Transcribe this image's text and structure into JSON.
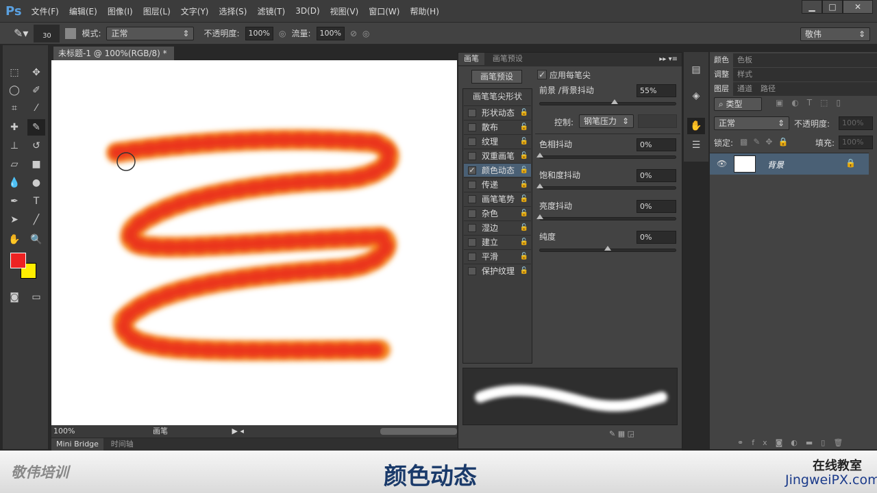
{
  "app": {
    "logo": "Ps",
    "menus": [
      "文件(F)",
      "编辑(E)",
      "图像(I)",
      "图层(L)",
      "文字(Y)",
      "选择(S)",
      "滤镜(T)",
      "3D(D)",
      "视图(V)",
      "窗口(W)",
      "帮助(H)"
    ],
    "win_min": "▁",
    "win_max": "□",
    "win_close": "✕"
  },
  "options": {
    "brush_size": "30",
    "mode_label": "模式:",
    "mode_value": "正常",
    "opacity_label": "不透明度:",
    "opacity_value": "100%",
    "flow_label": "流量:",
    "flow_value": "100%",
    "workspace": "敬伟"
  },
  "document": {
    "tab_title": "未标题-1 @ 100%(RGB/8) *",
    "close": "×",
    "zoom": "100%",
    "status_info": "画笔"
  },
  "bottom_tabs": [
    "Mini Bridge",
    "时间轴"
  ],
  "brush_panel": {
    "tabs": [
      "画笔",
      "画笔预设"
    ],
    "preset_button": "画笔预设",
    "tip_shape": "画笔笔尖形状",
    "items": [
      {
        "label": "形状动态",
        "checked": false
      },
      {
        "label": "散布",
        "checked": false
      },
      {
        "label": "纹理",
        "checked": false
      },
      {
        "label": "双重画笔",
        "checked": false
      },
      {
        "label": "颜色动态",
        "checked": true
      },
      {
        "label": "传递",
        "checked": false
      },
      {
        "label": "画笔笔势",
        "checked": false
      },
      {
        "label": "杂色",
        "checked": false
      },
      {
        "label": "湿边",
        "checked": false
      },
      {
        "label": "建立",
        "checked": false
      },
      {
        "label": "平滑",
        "checked": false
      },
      {
        "label": "保护纹理",
        "checked": false
      }
    ],
    "apply_per_tip": "应用每笔尖",
    "fg_bg_label": "前景 /背景抖动",
    "fg_bg_value": "55%",
    "control_label": "控制:",
    "control_value": "钢笔压力",
    "hue_label": "色相抖动",
    "hue_value": "0%",
    "sat_label": "饱和度抖动",
    "sat_value": "0%",
    "bright_label": "亮度抖动",
    "bright_value": "0%",
    "purity_label": "纯度",
    "purity_value": "0%"
  },
  "right_panels": {
    "color_tabs": [
      "颜色",
      "色板"
    ],
    "adjust_tabs": [
      "调整",
      "样式"
    ],
    "layer_tabs": [
      "图层",
      "通道",
      "路径"
    ],
    "filter_kind": "类型",
    "blend_mode": "正常",
    "opacity_label": "不透明度:",
    "opacity_value": "100%",
    "lock_label": "锁定:",
    "fill_label": "填充:",
    "fill_value": "100%",
    "layer_name": "背景"
  },
  "colors": {
    "foreground": "#ee2222",
    "background": "#ffee00",
    "accent": "#4a6075"
  },
  "banner": {
    "brand": "敬伟培训",
    "title": "颜色动态",
    "school": "在线教室",
    "site": "JingweiPX.com"
  }
}
